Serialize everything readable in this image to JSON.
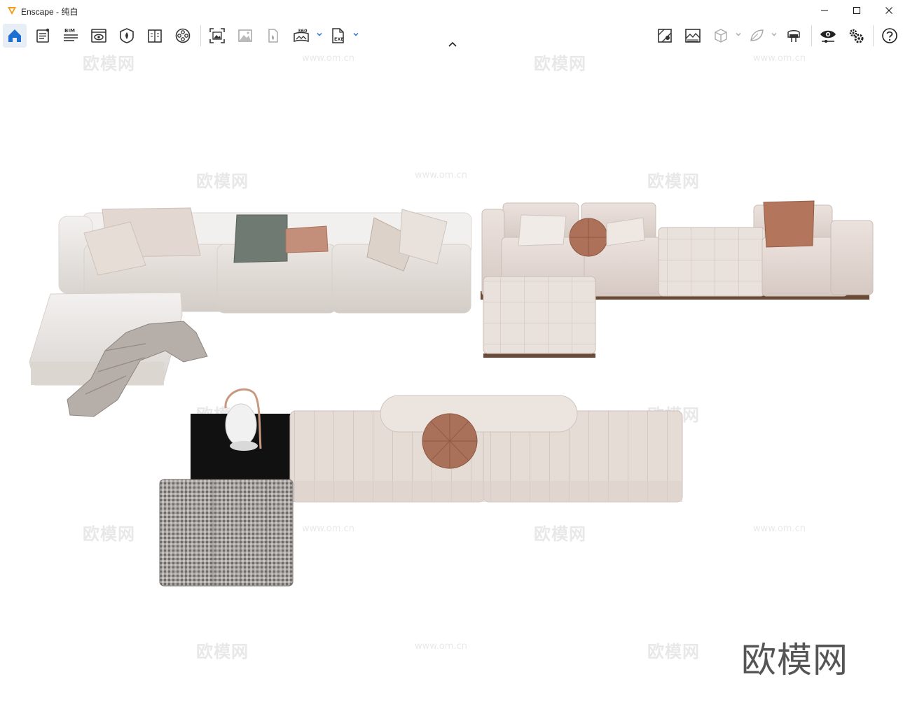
{
  "window": {
    "app_name": "Enscape",
    "separator": " - ",
    "document": "纯白",
    "accent": "#f39c12"
  },
  "toolbar": {
    "left_buttons": [
      {
        "name": "home-button",
        "icon": "home-icon",
        "active": true
      },
      {
        "name": "notes-button",
        "icon": "notes-icon",
        "text": ""
      },
      {
        "name": "bim-button",
        "icon": "bim-icon",
        "text": "BIM"
      },
      {
        "name": "views-button",
        "icon": "eye-monitor-icon"
      },
      {
        "name": "assets-button",
        "icon": "shield-icon"
      },
      {
        "name": "library-button",
        "icon": "book-icon"
      },
      {
        "name": "video-button",
        "icon": "film-reel-icon"
      },
      {
        "name": "render-image-button",
        "icon": "screenshot-icon"
      },
      {
        "name": "batch-render-button",
        "icon": "image-icon"
      },
      {
        "name": "material-button",
        "icon": "paint-icon"
      },
      {
        "name": "panorama-button",
        "icon": "panorama-360-icon",
        "text": "360"
      },
      {
        "name": "export-exe-button",
        "icon": "exe-file-icon",
        "text": "EXE"
      }
    ],
    "right_buttons": [
      {
        "name": "map-button",
        "icon": "map-pin-icon"
      },
      {
        "name": "atmosphere-button",
        "icon": "landscape-icon"
      },
      {
        "name": "cube-button",
        "icon": "cube-icon"
      },
      {
        "name": "leaf-button",
        "icon": "leaf-icon"
      },
      {
        "name": "vr-button",
        "icon": "vr-headset-icon"
      },
      {
        "name": "visual-settings-button",
        "icon": "eye-slider-icon"
      },
      {
        "name": "settings-button",
        "icon": "gears-icon"
      },
      {
        "name": "help-button",
        "icon": "help-icon"
      }
    ]
  },
  "viewport": {
    "background": "#ffffff",
    "watermark_cn": "欧模网",
    "watermark_url": "www.om.cn",
    "brand": "欧模网"
  },
  "colors": {
    "sofa_white": "#ece9e6",
    "sofa_shadow": "#cfcac6",
    "beige": "#e6dcd6",
    "sage": "#6e7a72",
    "terracotta": "#b3765d",
    "wood": "#6a4a36",
    "black_table": "#111111",
    "houndstooth": "#8e8a88"
  }
}
